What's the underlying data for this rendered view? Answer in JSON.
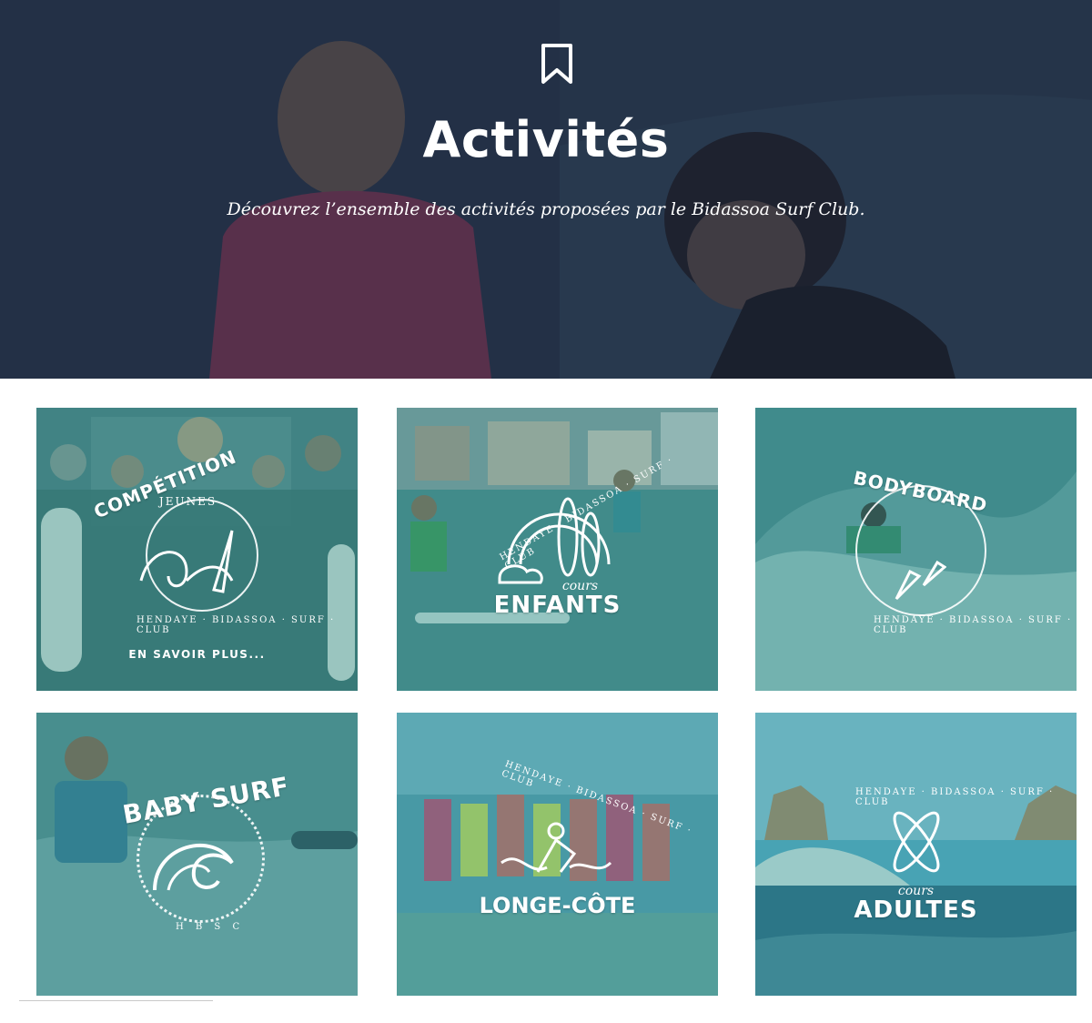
{
  "hero": {
    "title": "Activités",
    "subtitle": "Découvrez l’ensemble des activités proposées par le Bidassoa Surf Club.",
    "icon": "bookmark-icon"
  },
  "cards": [
    {
      "title": "COMPÉTITION",
      "subtitle": "JEUNES",
      "arc": "HENDAYE · BIDASSOA · SURF · CLUB",
      "link": "EN SAVOIR PLUS..."
    },
    {
      "title": "ENFANTS",
      "subtitle": "cours",
      "arc": "HENDAYE · BIDASSOA · SURF · CLUB"
    },
    {
      "title": "BODYBOARD",
      "arc": "HENDAYE · BIDASSOA · SURF · CLUB"
    },
    {
      "title": "BABY SURF",
      "arc": "H B S C"
    },
    {
      "title": "LONGE-CÔTE",
      "arc": "HENDAYE · BIDASSOA · SURF · CLUB"
    },
    {
      "title": "ADULTES",
      "subtitle": "cours",
      "arc": "HENDAYE · BIDASSOA · SURF · CLUB"
    }
  ],
  "colors": {
    "tint": "#2b8c82",
    "hero_overlay": "#1e2840"
  }
}
